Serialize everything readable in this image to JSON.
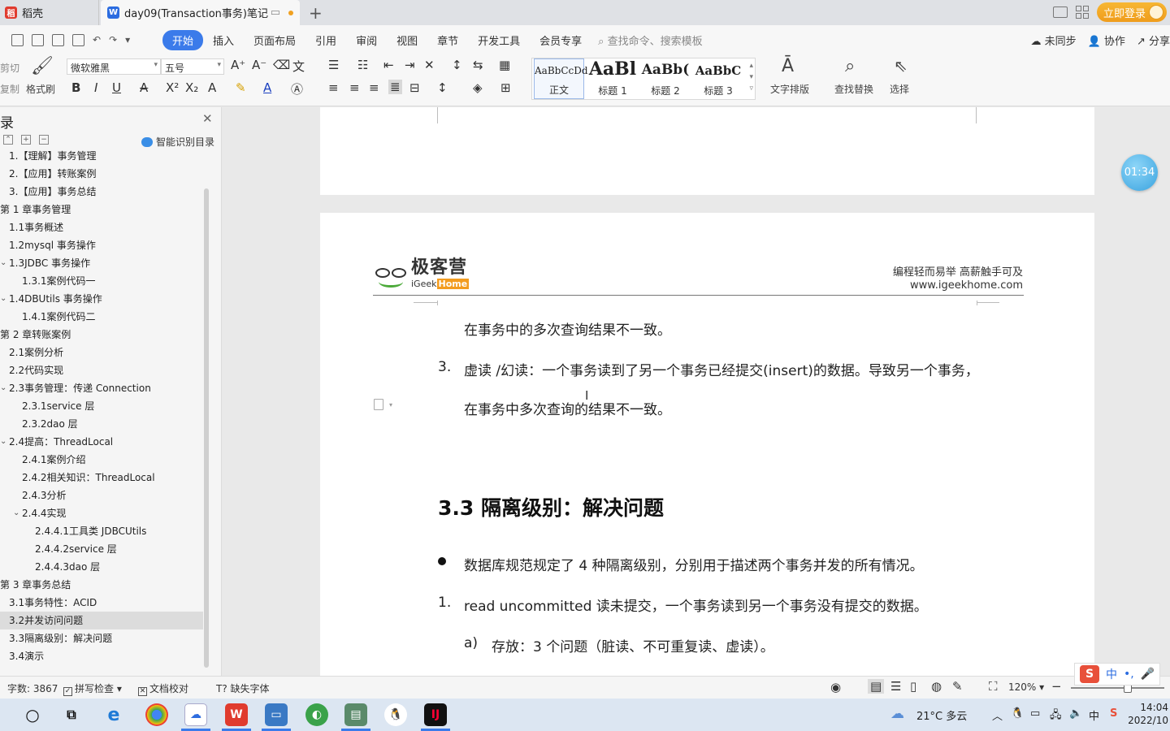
{
  "window": {
    "tab_home": "稻壳",
    "tab_doc": "day09(Transaction事务)笔记",
    "login": "立即登录"
  },
  "menu": {
    "items": [
      "开始",
      "插入",
      "页面布局",
      "引用",
      "审阅",
      "视图",
      "章节",
      "开发工具",
      "会员专享"
    ],
    "search": "查找命令、搜索模板",
    "unsync": "未同步",
    "collab": "协作",
    "share": "分享"
  },
  "ribbon": {
    "cut": "剪切",
    "copy": "复制",
    "format_painter": "格式刷",
    "font": "微软雅黑",
    "size": "五号",
    "styles": [
      {
        "preview": "AaBbCcDd",
        "name": "正文"
      },
      {
        "preview": "AaBl",
        "name": "标题 1"
      },
      {
        "preview": "AaBb(",
        "name": "标题 2"
      },
      {
        "preview": "AaBbC",
        "name": "标题 3"
      }
    ],
    "text_layout": "文字排版",
    "find_replace": "查找替换",
    "select": "选择"
  },
  "sidebar": {
    "title": "录",
    "smart_toc": "智能识别目录",
    "items": [
      {
        "label": "1.【理解】事务管理",
        "level": 1
      },
      {
        "label": "2.【应用】转账案例",
        "level": 1
      },
      {
        "label": "3.【应用】事务总结",
        "level": 1
      },
      {
        "label": "第 1 章事务管理",
        "level": 0
      },
      {
        "label": "1.1事务概述",
        "level": 1
      },
      {
        "label": "1.2mysql 事务操作",
        "level": 1
      },
      {
        "label": "1.3JDBC 事务操作",
        "level": 1,
        "caret": true
      },
      {
        "label": "1.3.1案例代码一",
        "level": 2
      },
      {
        "label": "1.4DBUtils 事务操作",
        "level": 1,
        "caret": true
      },
      {
        "label": "1.4.1案例代码二",
        "level": 2
      },
      {
        "label": "第 2 章转账案例",
        "level": 0
      },
      {
        "label": "2.1案例分析",
        "level": 1
      },
      {
        "label": "2.2代码实现",
        "level": 1
      },
      {
        "label": "2.3事务管理：传递 Connection",
        "level": 1,
        "caret": true
      },
      {
        "label": "2.3.1service 层",
        "level": 2
      },
      {
        "label": "2.3.2dao 层",
        "level": 2
      },
      {
        "label": "2.4提高：ThreadLocal",
        "level": 1,
        "caret": true
      },
      {
        "label": "2.4.1案例介绍",
        "level": 2
      },
      {
        "label": "2.4.2相关知识：ThreadLocal",
        "level": 2
      },
      {
        "label": "2.4.3分析",
        "level": 2
      },
      {
        "label": "2.4.4实现",
        "level": 2,
        "caret": true
      },
      {
        "label": "2.4.4.1工具类 JDBCUtils",
        "level": 3
      },
      {
        "label": "2.4.4.2service 层",
        "level": 3
      },
      {
        "label": "2.4.4.3dao 层",
        "level": 3
      },
      {
        "label": "第 3 章事务总结",
        "level": 0
      },
      {
        "label": "3.1事务特性：ACID",
        "level": 1
      },
      {
        "label": "3.2并发访问问题",
        "level": 1,
        "selected": true
      },
      {
        "label": "3.3隔离级别：解决问题",
        "level": 1
      },
      {
        "label": "3.4演示",
        "level": 1
      }
    ]
  },
  "page": {
    "logo_cn": "极客营",
    "logo_en_1": "iGeek",
    "logo_en_2": "Home",
    "slogan": "编程轻而易举  高薪触手可及",
    "site": "www.igeekhome.com",
    "line1": "在事务中的多次查询结果不一致。",
    "num3": "3.",
    "line2": "虚读  /幻读：一个事务读到了另一个事务已经提交(insert)的数据。导致另一个事务，",
    "line3": "在事务中多次查询的结果不一致。",
    "heading": "3.3 隔离级别：解决问题",
    "bullet_text": "数据库规范规定了 4 种隔离级别，分别用于描述两个事务并发的所有情况。",
    "num1": "1.",
    "item1": "read uncommitted  读未提交，一个事务读到另一个事务没有提交的数据。",
    "sub_a": "a)",
    "sub_a_text": "存放：3 个问题（脏读、不可重复读、虚读）。"
  },
  "timer": "01:34",
  "status": {
    "word_count": "字数: 3867",
    "spell_check": "拼写检查",
    "doc_check": "文档校对",
    "missing_font": "缺失字体",
    "zoom": "120%"
  },
  "ime": {
    "logo": "S",
    "mode": "中"
  },
  "taskbar": {
    "weather": "21°C  多云",
    "time": "14:04",
    "date": "2022/10"
  }
}
